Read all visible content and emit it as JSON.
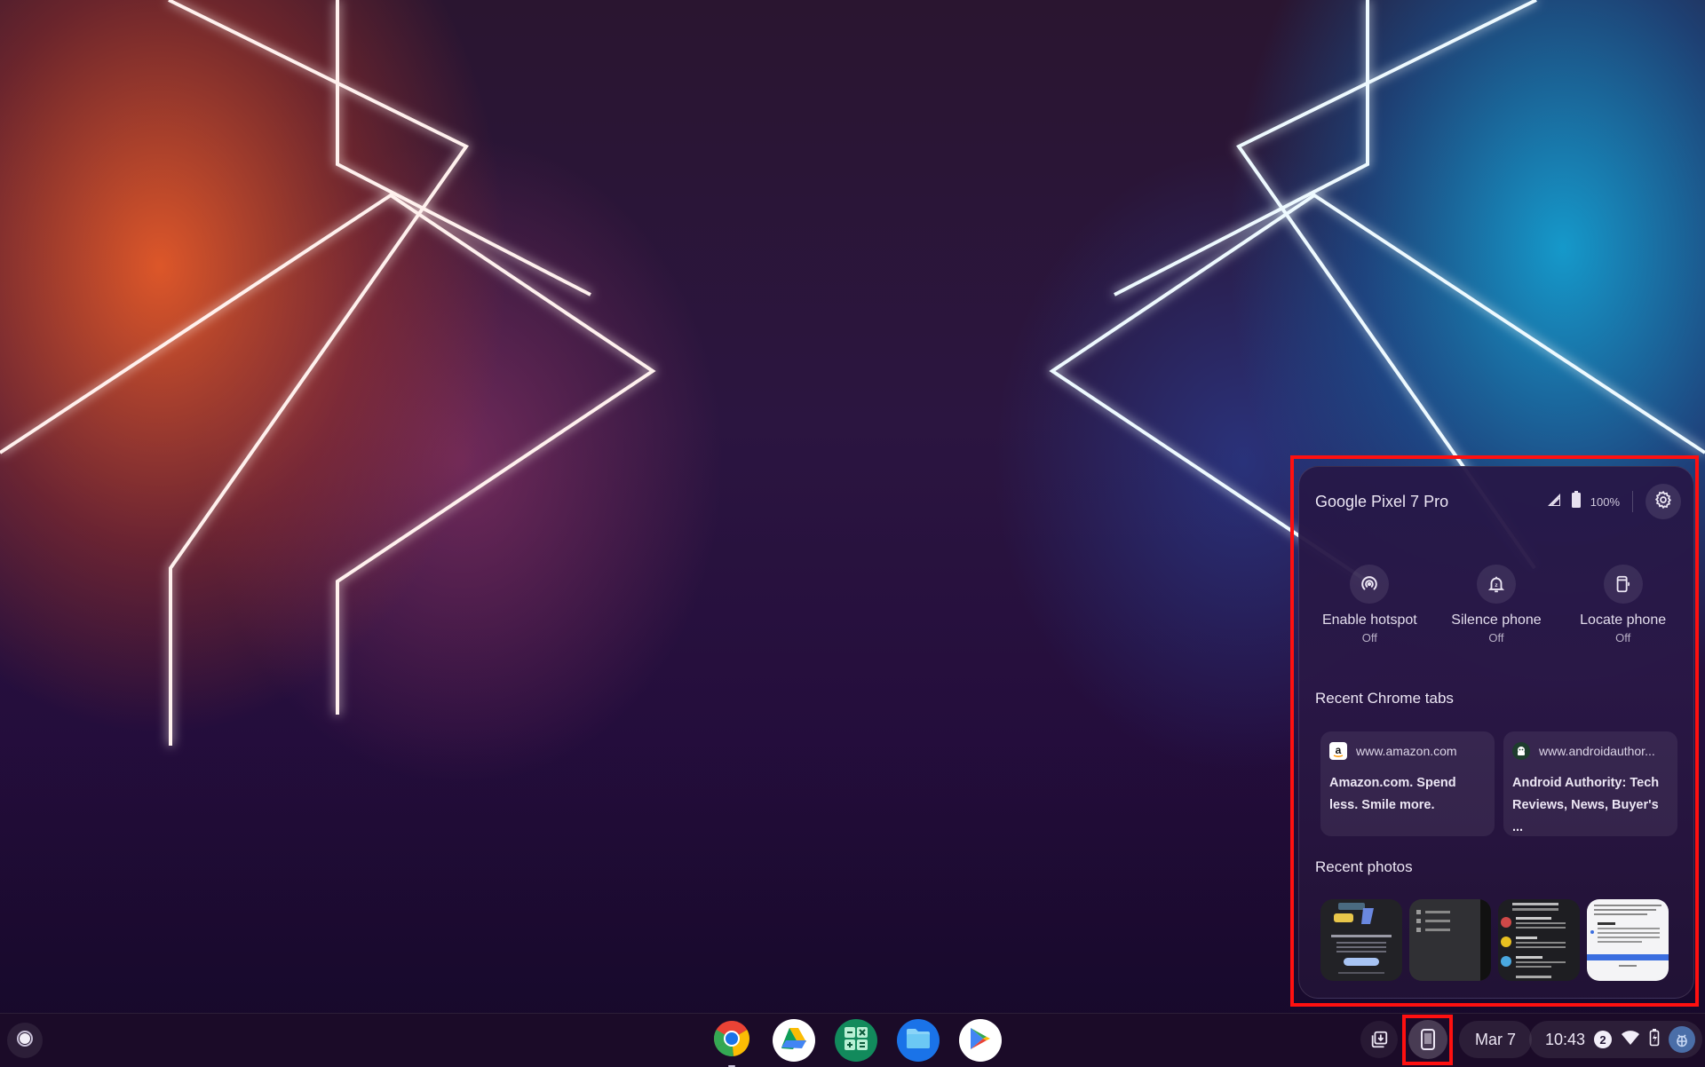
{
  "phone_hub": {
    "device_name": "Google Pixel 7 Pro",
    "signal_icon": "signal-icon",
    "battery_icon": "battery-icon",
    "battery_percent": "100%",
    "settings_icon": "gear-icon",
    "features": [
      {
        "icon": "hotspot-icon",
        "label": "Enable hotspot",
        "state": "Off"
      },
      {
        "icon": "silence-phone-icon",
        "label": "Silence phone",
        "state": "Off"
      },
      {
        "icon": "locate-phone-icon",
        "label": "Locate phone",
        "state": "Off"
      }
    ],
    "recent_tabs_title": "Recent Chrome tabs",
    "recent_tabs": [
      {
        "favicon": "amazon-favicon",
        "site": "www.amazon.com",
        "title": "Amazon.com. Spend less. Smile more."
      },
      {
        "favicon": "androidauthority-favicon",
        "site": "www.androidauthor...",
        "title": "Android Authority: Tech Reviews, News, Buyer's ..."
      }
    ],
    "recent_photos_title": "Recent photos",
    "recent_photos": [
      {
        "name": "photo-screenshot-1"
      },
      {
        "name": "photo-screenshot-2"
      },
      {
        "name": "photo-screenshot-3"
      },
      {
        "name": "photo-screenshot-4"
      }
    ]
  },
  "shelf": {
    "launcher_icon": "launcher-icon",
    "apps": [
      {
        "name": "Chrome",
        "icon": "chrome-icon"
      },
      {
        "name": "Google Drive",
        "icon": "drive-icon"
      },
      {
        "name": "Calculator",
        "icon": "calculator-icon"
      },
      {
        "name": "Files",
        "icon": "files-icon"
      },
      {
        "name": "Play Store",
        "icon": "play-store-icon"
      }
    ],
    "holding_space_icon": "holding-space-icon",
    "phone_hub_icon": "phone-icon",
    "date": "Mar 7",
    "time": "10:43",
    "notification_count": "2",
    "wifi_icon": "wifi-icon",
    "battery_icon": "battery-charging-icon",
    "account_icon": "avatar"
  },
  "colors": {
    "highlight": "#ff1010",
    "panel_bg": "#261848",
    "shelf_bg": "#1c0c28"
  }
}
